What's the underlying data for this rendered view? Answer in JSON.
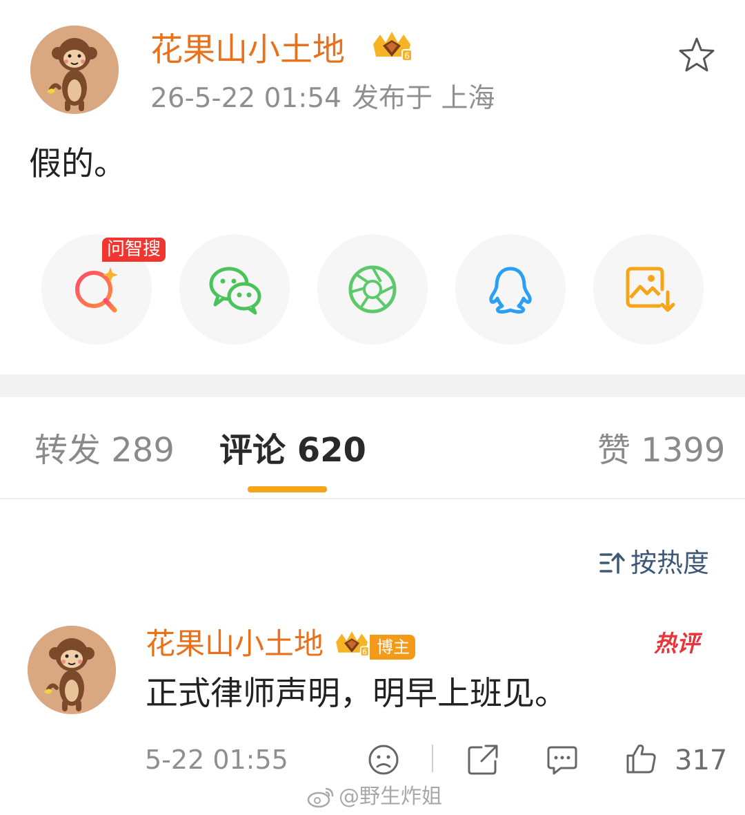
{
  "post": {
    "author": "花果山小土地",
    "time": "26-5-22 01:54",
    "location": "发布于 上海",
    "text": "假的。"
  },
  "share": {
    "ai_badge": "问智搜",
    "items": [
      "ai-search-icon",
      "wechat-icon",
      "moments-icon",
      "qq-icon",
      "save-image-icon"
    ]
  },
  "tabs": {
    "repost": "转发 289",
    "comment": "评论 620",
    "like": "赞 1399"
  },
  "sort": {
    "label": "按热度"
  },
  "comment": {
    "author": "花果山小土地",
    "badge": "博主",
    "hot_label": "热评",
    "text": "正式律师声明，明早上班见。",
    "time": "5-22 01:55",
    "likes": "317"
  },
  "watermark": "@野生炸姐",
  "colors": {
    "username": "#e8721b",
    "tab_underline": "#f6a418",
    "hot": "#e8343a",
    "ai_badge": "#f0362f"
  }
}
